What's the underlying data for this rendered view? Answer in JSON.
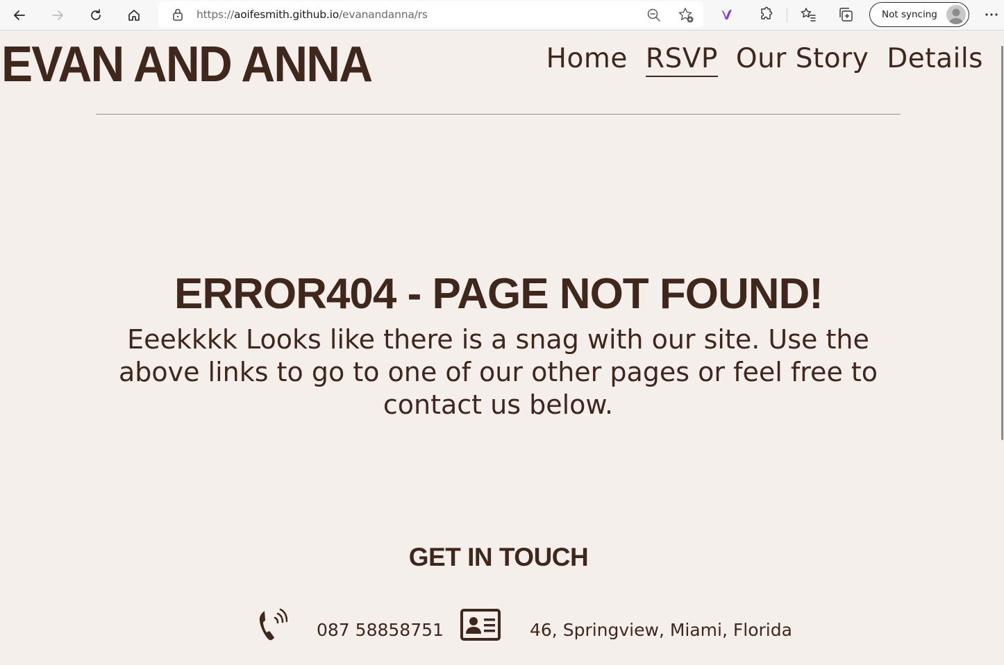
{
  "browser": {
    "url_scheme": "https://",
    "url_host": "aoifesmith.github.io",
    "url_path": "/evanandanna/rs",
    "sync_label": "Not syncing"
  },
  "site": {
    "title": "EVAN AND ANNA",
    "nav": [
      {
        "label": "Home",
        "active": false
      },
      {
        "label": "RSVP",
        "active": true
      },
      {
        "label": "Our Story",
        "active": false
      },
      {
        "label": "Details",
        "active": false
      }
    ]
  },
  "error": {
    "heading": "ERROR404 - PAGE NOT FOUND!",
    "message": "Eeekkkk Looks like there is a snag with our site. Use the above links to go to one of our other pages or feel free to contact us below."
  },
  "contact": {
    "heading": "GET IN TOUCH",
    "phone": "087 58858751",
    "address": "46, Springview, Miami, Florida"
  },
  "colors": {
    "background": "#f5efeb",
    "text": "#40271c"
  }
}
